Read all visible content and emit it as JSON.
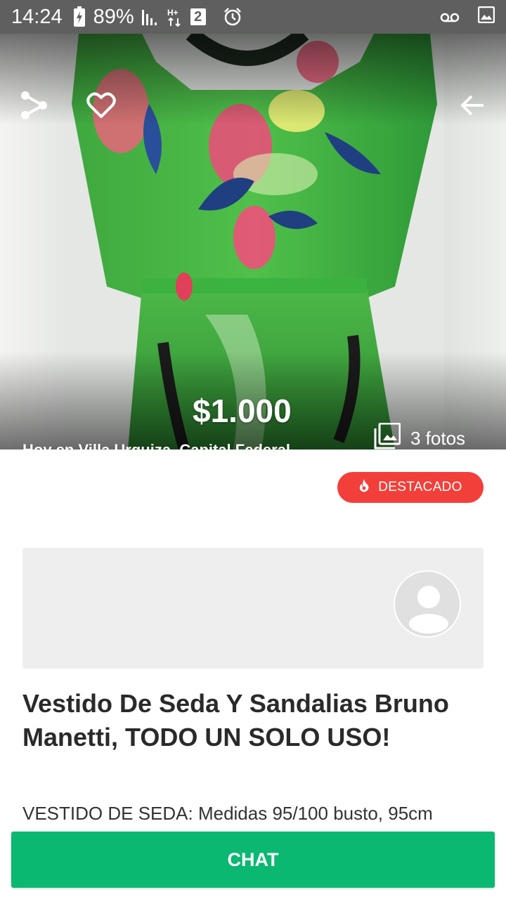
{
  "status_bar": {
    "time": "14:24",
    "battery": "89%",
    "sim_label": "2"
  },
  "listing": {
    "price": "$1.000",
    "location": "Hoy en Villa Urquiza, Capital Federal",
    "photos_label": "3 fotos",
    "badge": "DESTACADO",
    "title": "Vestido De Seda Y Sandalias Bruno Manetti, TODO UN SOLO USO!",
    "description": "VESTIDO DE SEDA: Medidas 95/100 busto, 95cm"
  },
  "actions": {
    "chat_label": "CHAT"
  },
  "icons": {
    "share": "share-icon",
    "favorite": "heart-icon",
    "back": "arrow-left-icon",
    "photos": "gallery-icon",
    "badge": "flame-icon",
    "avatar": "user-avatar-icon"
  },
  "colors": {
    "status_bar": "#5f5f5f",
    "badge": "#f23f3a",
    "chat_button": "#0bb872",
    "card_bg": "#eeeeee"
  }
}
